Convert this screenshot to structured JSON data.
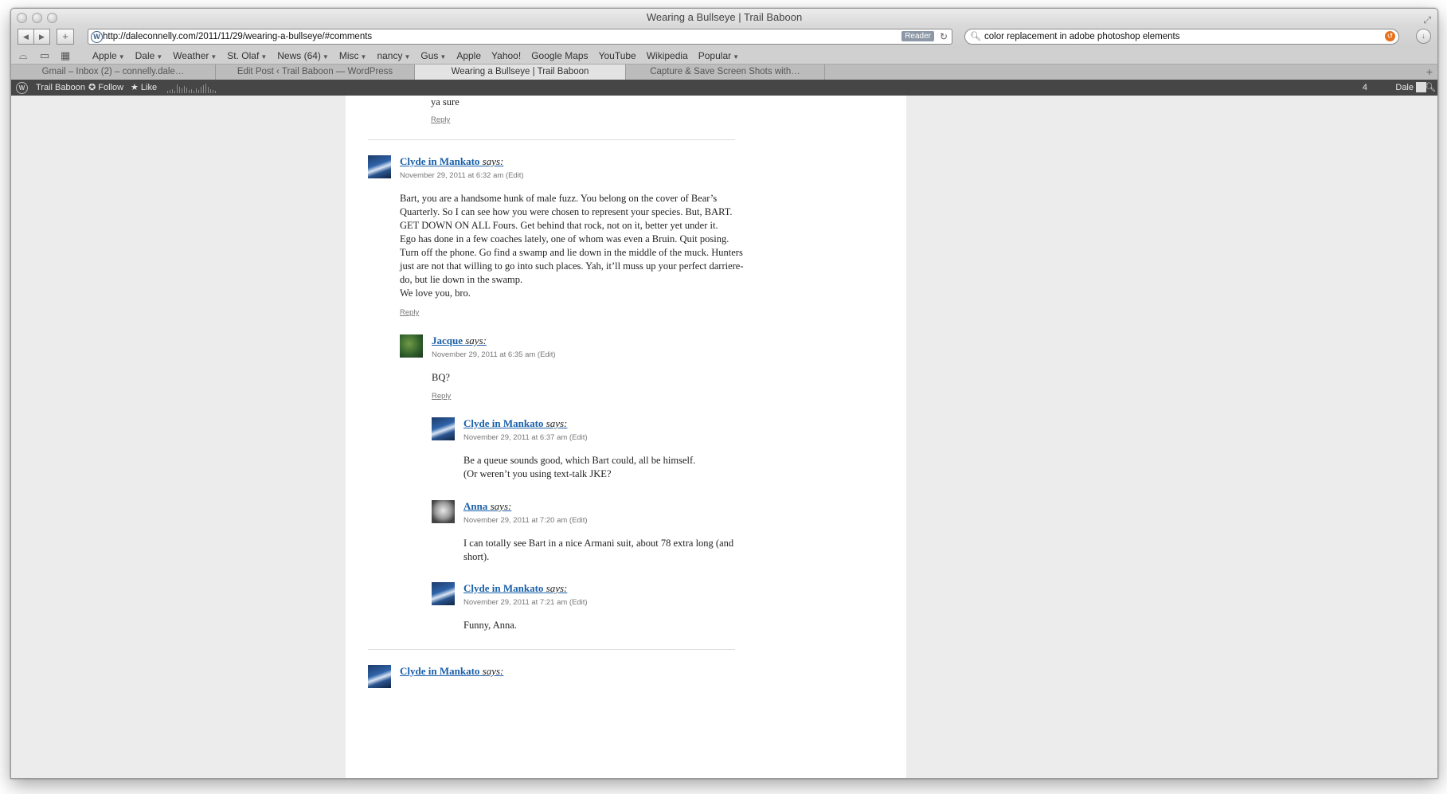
{
  "window": {
    "title": "Wearing a Bullseye | Trail Baboon"
  },
  "toolbar": {
    "url": "http://daleconnelly.com/2011/11/29/wearing-a-bullseye/#comments",
    "reader_label": "Reader",
    "search_value": "color replacement in adobe photoshop elements"
  },
  "bookmarks": [
    {
      "label": "Apple",
      "menu": true
    },
    {
      "label": "Dale",
      "menu": true
    },
    {
      "label": "Weather",
      "menu": true
    },
    {
      "label": "St. Olaf",
      "menu": true
    },
    {
      "label": "News (64)",
      "menu": true
    },
    {
      "label": "Misc",
      "menu": true
    },
    {
      "label": "nancy",
      "menu": true
    },
    {
      "label": "Gus",
      "menu": true
    },
    {
      "label": "Apple",
      "menu": false
    },
    {
      "label": "Yahoo!",
      "menu": false
    },
    {
      "label": "Google Maps",
      "menu": false
    },
    {
      "label": "YouTube",
      "menu": false
    },
    {
      "label": "Wikipedia",
      "menu": false
    },
    {
      "label": "Popular",
      "menu": true
    }
  ],
  "tabs": [
    {
      "label": "Gmail – Inbox (2) – connelly.dale…",
      "active": false
    },
    {
      "label": "Edit Post ‹ Trail Baboon — WordPress",
      "active": false
    },
    {
      "label": "Wearing a Bullseye | Trail Baboon",
      "active": true
    },
    {
      "label": "Capture & Save Screen Shots with…",
      "active": false
    }
  ],
  "adminbar": {
    "site": "Trail Baboon",
    "follow": "Follow",
    "like": "Like",
    "notifications": "4",
    "user": "Dale"
  },
  "comments": {
    "top_fragment": {
      "text": "ya sure",
      "reply": "Reply"
    },
    "c1": {
      "author": "Clyde in Mankato",
      "says": "says:",
      "date": "November 29, 2011 at 6:32 am (Edit)",
      "lines": [
        "Bart, you are a handsome hunk of male fuzz. You belong on the cover of Bear’s",
        "Quarterly. So I can see how you were chosen to represent your species. But, BART.",
        "GET DOWN ON ALL Fours. Get behind that rock, not on it, better yet under it.",
        "Ego has done in a few coaches lately, one of whom was even a Bruin. Quit posing.",
        "Turn off the phone. Go find a swamp and lie down in the middle of the muck. Hunters",
        "just are not that willing to go into such places. Yah, it’ll muss up your perfect darriere-",
        "do, but lie down in the swamp.",
        "We love you, bro."
      ],
      "reply": "Reply"
    },
    "c2": {
      "author": "Jacque",
      "says": "says:",
      "date": "November 29, 2011 at 6:35 am (Edit)",
      "lines": [
        "BQ?"
      ],
      "reply": "Reply"
    },
    "c3": {
      "author": "Clyde in Mankato",
      "says": "says:",
      "date": "November 29, 2011 at 6:37 am (Edit)",
      "lines": [
        "Be a queue sounds good, which Bart could, all be himself.",
        "(Or weren’t you using text-talk JKE?"
      ]
    },
    "c4": {
      "author": "Anna",
      "says": "says:",
      "date": "November 29, 2011 at 7:20 am (Edit)",
      "lines": [
        "I can totally see Bart in a nice Armani suit, about 78 extra long (and",
        "short)."
      ]
    },
    "c5": {
      "author": "Clyde in Mankato",
      "says": "says:",
      "date": "November 29, 2011 at 7:21 am (Edit)",
      "lines": [
        "Funny, Anna."
      ]
    },
    "c6": {
      "author": "Clyde in Mankato",
      "says": "says:"
    }
  }
}
